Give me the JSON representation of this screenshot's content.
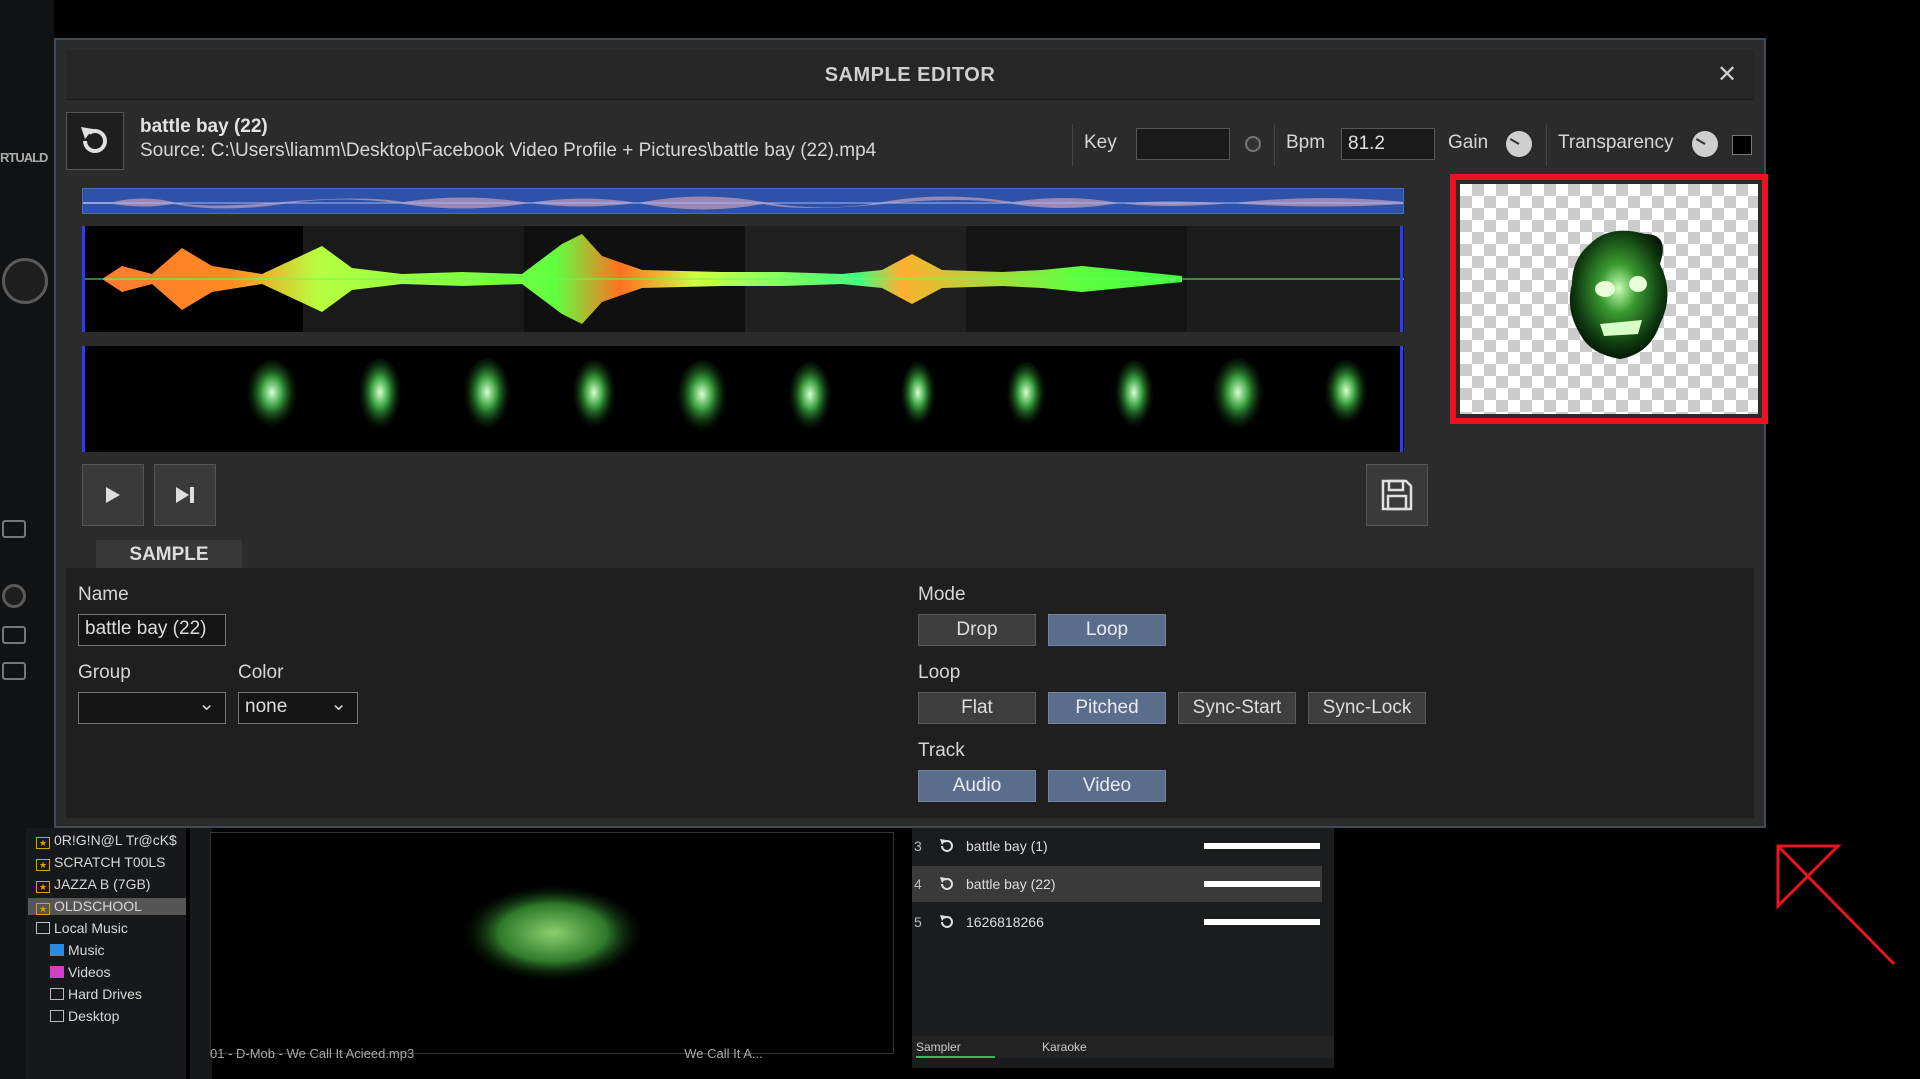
{
  "window": {
    "title": "SAMPLE EDITOR",
    "close_symbol": "✕"
  },
  "sample": {
    "name": "battle bay (22)",
    "source": "Source: C:\\Users\\liamm\\Desktop\\Facebook Video Profile + Pictures\\battle bay (22).mp4"
  },
  "header": {
    "key_label": "Key",
    "key_value": "",
    "bpm_label": "Bpm",
    "bpm_value": "81.2",
    "gain_label": "Gain",
    "transparency_label": "Transparency"
  },
  "tabs": {
    "sample_label": "SAMPLE"
  },
  "panel": {
    "name_label": "Name",
    "name_value": "battle bay (22)",
    "group_label": "Group",
    "group_value": "",
    "color_label": "Color",
    "color_value": "none",
    "mode_label": "Mode",
    "mode_buttons": [
      {
        "label": "Drop",
        "active": false
      },
      {
        "label": "Loop",
        "active": true
      }
    ],
    "loop_label": "Loop",
    "loop_buttons": [
      {
        "label": "Flat",
        "active": false
      },
      {
        "label": "Pitched",
        "active": true
      },
      {
        "label": "Sync-Start",
        "active": false
      },
      {
        "label": "Sync-Lock",
        "active": false
      }
    ],
    "track_label": "Track",
    "track_buttons": [
      {
        "label": "Audio",
        "active": true
      },
      {
        "label": "Video",
        "active": true
      }
    ]
  },
  "browser": {
    "tree": [
      {
        "label": "0R!G!N@L Tr@cK$",
        "icon": "star-folder-icon"
      },
      {
        "label": "SCRATCH T00LS",
        "icon": "star-folder-icon"
      },
      {
        "label": "JAZZA B (7GB)",
        "icon": "star-folder-icon"
      },
      {
        "label": "OLDSCHOOL",
        "icon": "star-folder-icon",
        "selected": true
      },
      {
        "label": "Local Music",
        "icon": "computer-icon"
      },
      {
        "label": "Music",
        "icon": "music-folder-icon"
      },
      {
        "label": "Videos",
        "icon": "video-folder-icon"
      },
      {
        "label": "Hard Drives",
        "icon": "drive-icon"
      },
      {
        "label": "Desktop",
        "icon": "desktop-icon"
      }
    ],
    "bottom_track": "01 - D-Mob - We Call It Acieed.mp3",
    "bottom_track_right": "We Call It A..."
  },
  "sampler": {
    "rows": [
      {
        "num": "3",
        "name": "battle bay (1)",
        "selected": false
      },
      {
        "num": "4",
        "name": "battle bay (22)",
        "selected": true
      },
      {
        "num": "5",
        "name": "1626818266",
        "selected": false
      }
    ],
    "tab_sampler": "Sampler",
    "tab_karaoke": "Karaoke"
  },
  "colors": {
    "accent_red": "#e8141e",
    "active_button": "#5a6e8c",
    "overview_blue": "#2d52a8"
  }
}
